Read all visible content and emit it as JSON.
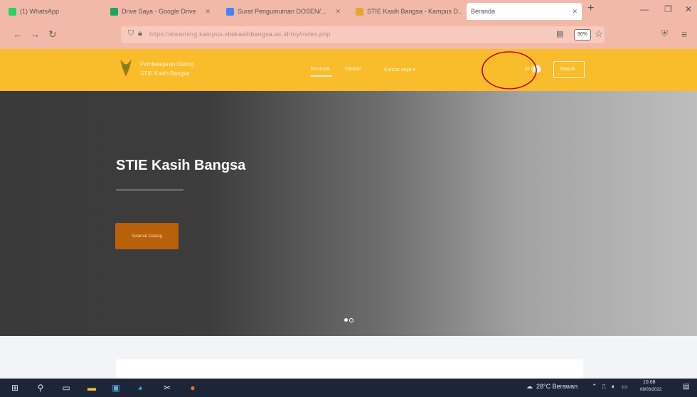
{
  "browser": {
    "tabs": [
      {
        "label": "(1) WhatsApp",
        "color": "#25d366"
      },
      {
        "label": "Drive Saya - Google Drive",
        "color": "#1fa463"
      },
      {
        "label": "Surat Pengumuman DOSEN/...",
        "color": "#4285f4"
      },
      {
        "label": "STIE Kasih Bangsa - Kampus D...",
        "color": "#e4a72a"
      },
      {
        "label": "Beranda",
        "color": "#ffffff"
      }
    ],
    "new_tab_label": "+",
    "window_controls": {
      "minimize": "—",
      "close": "✕"
    },
    "nav": {
      "back": "←",
      "forward": "→",
      "reload": "↻"
    },
    "address_bar": {
      "url_prefix": "https://elearning.kampus.",
      "url_domain": "stiekasihbangsa.ac.id",
      "url_suffix": "/my/index.php"
    },
    "zoom_level": "90%"
  },
  "site": {
    "brand_line1": "Pembelajaran Daring",
    "brand_line2": "STIE Kasih Bangsa",
    "menu": [
      "Beranda",
      "Dasbor",
      "Kursus saya ▾"
    ],
    "login_label": "Masuk",
    "toggle_label": "Id"
  },
  "hero": {
    "title": "STIE Kasih Bangsa",
    "button_label": "Selamat Datang"
  },
  "taskbar": {
    "weather": "28°C Berawan",
    "time": "10:08",
    "date": "08/03/2022"
  },
  "colors": {
    "header": "#f9bd2c",
    "tab_strip": "#f3b9a8",
    "hero_button": "#b8600a",
    "annotation": "#cc0000"
  }
}
